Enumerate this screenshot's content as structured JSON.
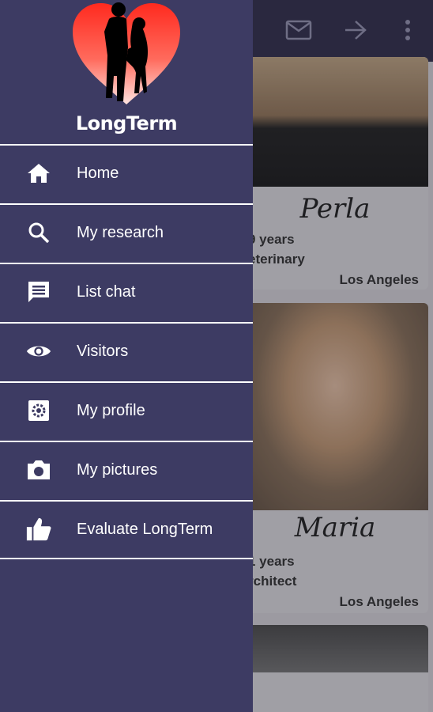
{
  "app": {
    "name": "LongTerm",
    "colors": {
      "drawer_background": "#3d3b63",
      "appbar": "#2b2944",
      "logo_heart": "#ff3b30",
      "divider": "#ffffff"
    }
  },
  "toolbar": {
    "actions": [
      {
        "icon": "mail-icon"
      },
      {
        "icon": "arrow-right-icon"
      },
      {
        "icon": "more-vert-icon"
      }
    ]
  },
  "drawer": {
    "brand": "LongTerm",
    "items": [
      {
        "icon": "home-icon",
        "label": "Home"
      },
      {
        "icon": "search-icon",
        "label": "My research"
      },
      {
        "icon": "chat-icon",
        "label": "List chat"
      },
      {
        "icon": "eye-icon",
        "label": "Visitors"
      },
      {
        "icon": "settings-icon",
        "label": "My profile"
      },
      {
        "icon": "camera-icon",
        "label": "My pictures"
      },
      {
        "icon": "thumb-up-icon",
        "label": "Evaluate LongTerm"
      }
    ]
  },
  "profiles": [
    {
      "name": "Perla",
      "age_text": "9 years",
      "job_text": "eterinary",
      "city": "Los Angeles"
    },
    {
      "name": "Maria",
      "age_text": "1 years",
      "job_text": "rchitect",
      "city": "Los Angeles"
    }
  ]
}
